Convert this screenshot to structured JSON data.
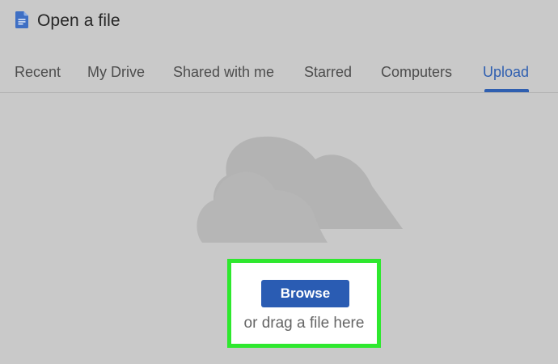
{
  "dialog": {
    "title": "Open a file",
    "title_icon": "docs-file-icon"
  },
  "tabs": [
    {
      "label": "Recent",
      "active": false
    },
    {
      "label": "My Drive",
      "active": false
    },
    {
      "label": "Shared with me",
      "active": false
    },
    {
      "label": "Starred",
      "active": false
    },
    {
      "label": "Computers",
      "active": false
    },
    {
      "label": "Upload",
      "active": true
    }
  ],
  "upload": {
    "illustration": "cloud-icon",
    "browse_label": "Browse",
    "drag_hint": "or drag a file here"
  },
  "colors": {
    "background": "#c9c9c9",
    "accent": "#2f5fb0",
    "button": "#2a5cb3",
    "highlight_border": "#2ee82e",
    "cloud": "#b0b0b0"
  }
}
